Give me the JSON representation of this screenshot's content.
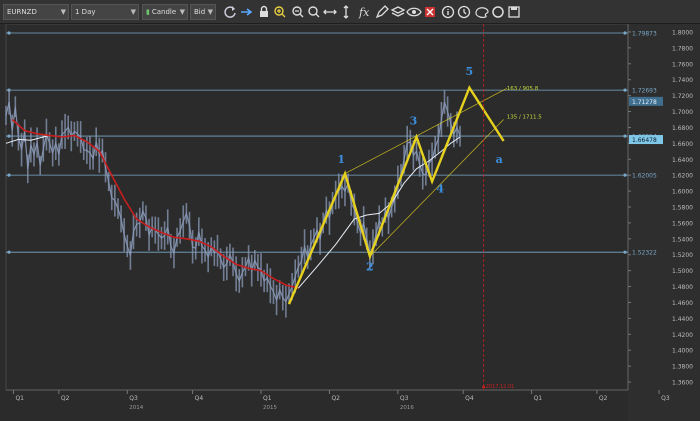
{
  "toolbar": {
    "symbol": "EURNZD",
    "timeframe": "1 Day",
    "chart_type": "Candle",
    "price_side": "Bid",
    "icons": [
      "refresh-icon",
      "crosshair-icon",
      "lock-icon",
      "zoom-in-icon",
      "zoom-out-icon",
      "zoom-fit-icon",
      "fit-width-icon",
      "fit-height-icon",
      "function-icon",
      "pencil-icon",
      "layers-icon",
      "eye-icon",
      "delete-icon",
      "info-icon",
      "time-icon",
      "palette-icon",
      "circle-icon",
      "save-icon"
    ]
  },
  "colors": {
    "background": "#2b2b2b",
    "price_line": "#8a9ab8",
    "ma_red": "#c81e1e",
    "ma_white": "#e8eef5",
    "wave": "#e6d21e",
    "hline": "#7aa8c8",
    "wave_label": "#3a8fe0",
    "fib_label": "#c8d840",
    "marker": "#c81e1e"
  },
  "chart_data": {
    "type": "line",
    "ylim": [
      1.35,
      1.81
    ],
    "y_ticks": [
      "1.8000",
      "1.7800",
      "1.7600",
      "1.7400",
      "1.7200",
      "1.7000",
      "1.6800",
      "1.6600",
      "1.6400",
      "1.6200",
      "1.6000",
      "1.5800",
      "1.5600",
      "1.5400",
      "1.5200",
      "1.5000",
      "1.4800",
      "1.4600",
      "1.4400",
      "1.4200",
      "1.4000",
      "1.3800",
      "1.3600"
    ],
    "x_ticks": [
      "Q1",
      "Q2",
      "Q3",
      "Q4",
      "Q1",
      "Q2",
      "Q3",
      "Q4",
      "Q1",
      "Q2",
      "Q3"
    ],
    "x_tick_pos": [
      0.012,
      0.085,
      0.195,
      0.3,
      0.41,
      0.52,
      0.63,
      0.735,
      0.845,
      0.95,
      1.05
    ],
    "year_labels": [
      "2014",
      "2015",
      "2016"
    ],
    "year_pos": [
      0.195,
      0.41,
      0.63
    ],
    "horizontal_levels": [
      {
        "value": 1.79873,
        "label": "1.79873"
      },
      {
        "value": 1.72693,
        "label": "1.72693"
      },
      {
        "value": 1.66914,
        "label": "1.66914"
      },
      {
        "value": 1.62005,
        "label": "1.62005"
      },
      {
        "value": 1.52322,
        "label": "1.52322"
      }
    ],
    "current_price": "1.66478",
    "marker_price": "1.71278",
    "price_series": [
      [
        0.0,
        1.695
      ],
      [
        0.005,
        1.712
      ],
      [
        0.01,
        1.676
      ],
      [
        0.015,
        1.706
      ],
      [
        0.02,
        1.668
      ],
      [
        0.025,
        1.652
      ],
      [
        0.03,
        1.676
      ],
      [
        0.035,
        1.628
      ],
      [
        0.04,
        1.658
      ],
      [
        0.045,
        1.646
      ],
      [
        0.05,
        1.661
      ],
      [
        0.055,
        1.632
      ],
      [
        0.06,
        1.653
      ],
      [
        0.065,
        1.671
      ],
      [
        0.07,
        1.661
      ],
      [
        0.075,
        1.648
      ],
      [
        0.08,
        1.66
      ],
      [
        0.085,
        1.646
      ],
      [
        0.09,
        1.671
      ],
      [
        0.095,
        1.675
      ],
      [
        0.1,
        1.68
      ],
      [
        0.105,
        1.669
      ],
      [
        0.11,
        1.675
      ],
      [
        0.115,
        1.672
      ],
      [
        0.12,
        1.668
      ],
      [
        0.125,
        1.652
      ],
      [
        0.13,
        1.651
      ],
      [
        0.135,
        1.648
      ],
      [
        0.14,
        1.641
      ],
      [
        0.145,
        1.662
      ],
      [
        0.15,
        1.645
      ],
      [
        0.155,
        1.651
      ],
      [
        0.16,
        1.63
      ],
      [
        0.165,
        1.612
      ],
      [
        0.17,
        1.592
      ],
      [
        0.175,
        1.588
      ],
      [
        0.18,
        1.578
      ],
      [
        0.185,
        1.565
      ],
      [
        0.19,
        1.545
      ],
      [
        0.195,
        1.531
      ],
      [
        0.2,
        1.519
      ],
      [
        0.205,
        1.549
      ],
      [
        0.21,
        1.558
      ],
      [
        0.215,
        1.56
      ],
      [
        0.22,
        1.575
      ],
      [
        0.225,
        1.566
      ],
      [
        0.23,
        1.545
      ],
      [
        0.235,
        1.555
      ],
      [
        0.24,
        1.551
      ],
      [
        0.245,
        1.546
      ],
      [
        0.25,
        1.541
      ],
      [
        0.255,
        1.544
      ],
      [
        0.26,
        1.555
      ],
      [
        0.265,
        1.531
      ],
      [
        0.27,
        1.522
      ],
      [
        0.275,
        1.542
      ],
      [
        0.28,
        1.55
      ],
      [
        0.285,
        1.562
      ],
      [
        0.29,
        1.572
      ],
      [
        0.295,
        1.557
      ],
      [
        0.3,
        1.53
      ],
      [
        0.305,
        1.528
      ],
      [
        0.31,
        1.549
      ],
      [
        0.315,
        1.531
      ],
      [
        0.32,
        1.526
      ],
      [
        0.325,
        1.517
      ],
      [
        0.33,
        1.53
      ],
      [
        0.335,
        1.522
      ],
      [
        0.34,
        1.525
      ],
      [
        0.345,
        1.515
      ],
      [
        0.35,
        1.504
      ],
      [
        0.355,
        1.509
      ],
      [
        0.36,
        1.52
      ],
      [
        0.365,
        1.511
      ],
      [
        0.37,
        1.496
      ],
      [
        0.375,
        1.487
      ],
      [
        0.38,
        1.498
      ],
      [
        0.385,
        1.505
      ],
      [
        0.39,
        1.516
      ],
      [
        0.395,
        1.5
      ],
      [
        0.4,
        1.513
      ],
      [
        0.405,
        1.504
      ],
      [
        0.41,
        1.501
      ],
      [
        0.415,
        1.487
      ],
      [
        0.42,
        1.491
      ],
      [
        0.425,
        1.481
      ],
      [
        0.43,
        1.473
      ],
      [
        0.435,
        1.463
      ],
      [
        0.44,
        1.476
      ],
      [
        0.445,
        1.466
      ],
      [
        0.45,
        1.461
      ],
      [
        0.455,
        1.471
      ],
      [
        0.46,
        1.48
      ],
      [
        0.465,
        1.493
      ],
      [
        0.47,
        1.505
      ],
      [
        0.475,
        1.512
      ],
      [
        0.48,
        1.53
      ],
      [
        0.485,
        1.517
      ],
      [
        0.49,
        1.532
      ],
      [
        0.495,
        1.541
      ],
      [
        0.5,
        1.551
      ],
      [
        0.505,
        1.54
      ],
      [
        0.51,
        1.56
      ],
      [
        0.515,
        1.576
      ],
      [
        0.52,
        1.566
      ],
      [
        0.525,
        1.585
      ],
      [
        0.53,
        1.595
      ],
      [
        0.535,
        1.6
      ],
      [
        0.54,
        1.606
      ],
      [
        0.545,
        1.6
      ],
      [
        0.55,
        1.61
      ],
      [
        0.555,
        1.585
      ],
      [
        0.56,
        1.577
      ],
      [
        0.565,
        1.56
      ],
      [
        0.57,
        1.548
      ],
      [
        0.575,
        1.56
      ],
      [
        0.58,
        1.54
      ],
      [
        0.585,
        1.52
      ],
      [
        0.59,
        1.53
      ],
      [
        0.595,
        1.546
      ],
      [
        0.6,
        1.563
      ],
      [
        0.605,
        1.555
      ],
      [
        0.61,
        1.576
      ],
      [
        0.615,
        1.566
      ],
      [
        0.62,
        1.58
      ],
      [
        0.625,
        1.59
      ],
      [
        0.63,
        1.611
      ],
      [
        0.635,
        1.62
      ],
      [
        0.64,
        1.64
      ],
      [
        0.645,
        1.66
      ],
      [
        0.65,
        1.662
      ],
      [
        0.655,
        1.645
      ],
      [
        0.66,
        1.65
      ],
      [
        0.665,
        1.634
      ],
      [
        0.67,
        1.622
      ],
      [
        0.675,
        1.62
      ],
      [
        0.68,
        1.635
      ],
      [
        0.685,
        1.64
      ],
      [
        0.69,
        1.655
      ],
      [
        0.695,
        1.666
      ],
      [
        0.7,
        1.69
      ],
      [
        0.705,
        1.712
      ],
      [
        0.71,
        1.7
      ],
      [
        0.715,
        1.686
      ],
      [
        0.72,
        1.671
      ],
      [
        0.725,
        1.68
      ],
      [
        0.73,
        1.669
      ]
    ],
    "ma_red": [
      [
        0.01,
        1.69
      ],
      [
        0.03,
        1.676
      ],
      [
        0.05,
        1.672
      ],
      [
        0.07,
        1.67
      ],
      [
        0.09,
        1.668
      ],
      [
        0.11,
        1.67
      ],
      [
        0.13,
        1.662
      ],
      [
        0.15,
        1.65
      ],
      [
        0.17,
        1.62
      ],
      [
        0.19,
        1.59
      ],
      [
        0.21,
        1.565
      ],
      [
        0.23,
        1.555
      ],
      [
        0.25,
        1.548
      ],
      [
        0.27,
        1.542
      ],
      [
        0.29,
        1.54
      ],
      [
        0.31,
        1.537
      ],
      [
        0.33,
        1.53
      ],
      [
        0.35,
        1.518
      ],
      [
        0.37,
        1.508
      ],
      [
        0.39,
        1.503
      ],
      [
        0.41,
        1.5
      ],
      [
        0.43,
        1.49
      ],
      [
        0.45,
        1.482
      ],
      [
        0.47,
        1.478
      ]
    ],
    "ma_white": [
      [
        0.0,
        1.66
      ],
      [
        0.02,
        1.665
      ],
      [
        0.04,
        1.664
      ],
      [
        0.06,
        1.668
      ],
      [
        0.07,
        1.67
      ],
      [
        0.47,
        1.478
      ],
      [
        0.5,
        1.505
      ],
      [
        0.53,
        1.533
      ],
      [
        0.56,
        1.565
      ],
      [
        0.58,
        1.57
      ],
      [
        0.6,
        1.572
      ],
      [
        0.62,
        1.585
      ],
      [
        0.64,
        1.61
      ],
      [
        0.66,
        1.628
      ],
      [
        0.68,
        1.638
      ],
      [
        0.7,
        1.65
      ],
      [
        0.715,
        1.66
      ],
      [
        0.73,
        1.668
      ]
    ],
    "waves": [
      [
        0.455,
        1.458
      ],
      [
        0.545,
        1.622
      ],
      [
        0.585,
        1.518
      ],
      [
        0.66,
        1.668
      ],
      [
        0.685,
        1.612
      ],
      [
        0.745,
        1.73
      ],
      [
        0.8,
        1.663
      ]
    ],
    "wave_labels": [
      {
        "text": "1",
        "x": 0.539,
        "y": 1.635
      },
      {
        "text": "2",
        "x": 0.585,
        "y": 1.5
      },
      {
        "text": "3",
        "x": 0.655,
        "y": 1.684
      },
      {
        "text": "4",
        "x": 0.698,
        "y": 1.598
      },
      {
        "text": "5",
        "x": 0.745,
        "y": 1.746
      },
      {
        "text": "a",
        "x": 0.793,
        "y": 1.635
      }
    ],
    "fib_labels": [
      {
        "text": "163 / 905.8",
        "x": 0.805,
        "y": 1.727
      },
      {
        "text": "135 / 1711.5",
        "x": 0.805,
        "y": 1.691
      }
    ],
    "channel": [
      {
        "from": [
          0.545,
          1.622
        ],
        "to": [
          0.805,
          1.729
        ]
      },
      {
        "from": [
          0.585,
          1.518
        ],
        "to": [
          0.8,
          1.69
        ]
      }
    ],
    "marker_line_x": 0.768,
    "marker_label": "2017.12.01"
  }
}
